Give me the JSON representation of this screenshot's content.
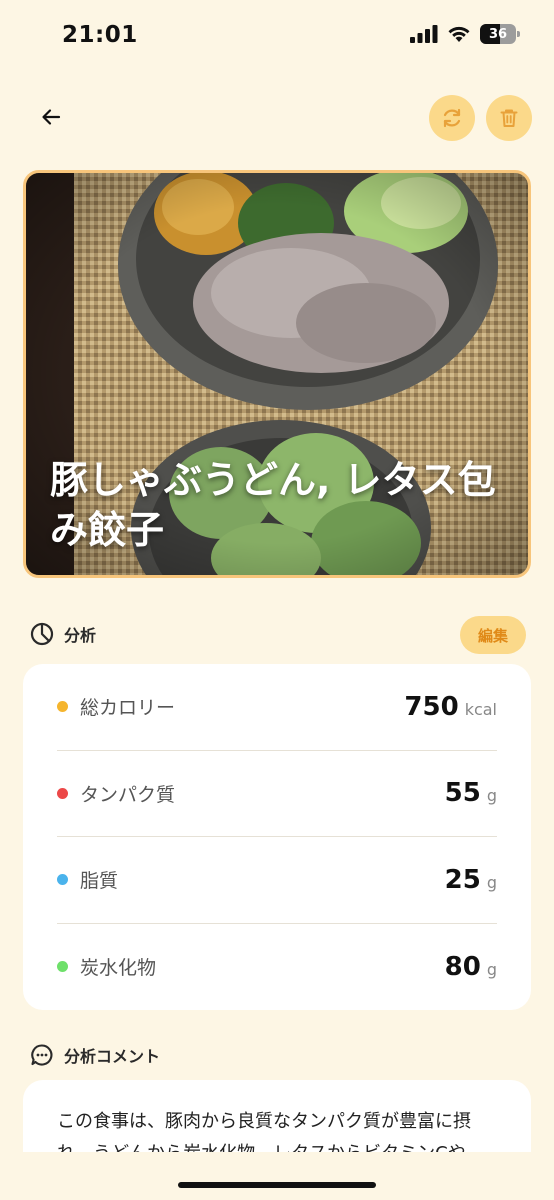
{
  "status": {
    "time": "21:01",
    "battery": "36"
  },
  "header": {
    "back_icon": "arrow-left-icon",
    "refresh_icon": "refresh-icon",
    "delete_icon": "trash-icon"
  },
  "meal": {
    "title": "豚しゃぶうどん, レタス包み餃子"
  },
  "analysis": {
    "section_title": "分析",
    "edit_label": "編集",
    "items": [
      {
        "label": "総カロリー",
        "value": "750",
        "unit": "kcal",
        "color": "#f5b52e"
      },
      {
        "label": "タンパク質",
        "value": "55",
        "unit": "g",
        "color": "#ec4848"
      },
      {
        "label": "脂質",
        "value": "25",
        "unit": "g",
        "color": "#4ab3ec"
      },
      {
        "label": "炭水化物",
        "value": "80",
        "unit": "g",
        "color": "#6ee06a"
      }
    ]
  },
  "comment": {
    "section_title": "分析コメント",
    "text": "この食事は、豚肉から良質なタンパク質が豊富に摂れ、うどんから炭水化物、レタスからビタミンCや"
  },
  "colors": {
    "background": "#fdf6e4",
    "accent": "#fbd98a",
    "accent_text": "#e08a18",
    "icon": "#e8a23a"
  }
}
